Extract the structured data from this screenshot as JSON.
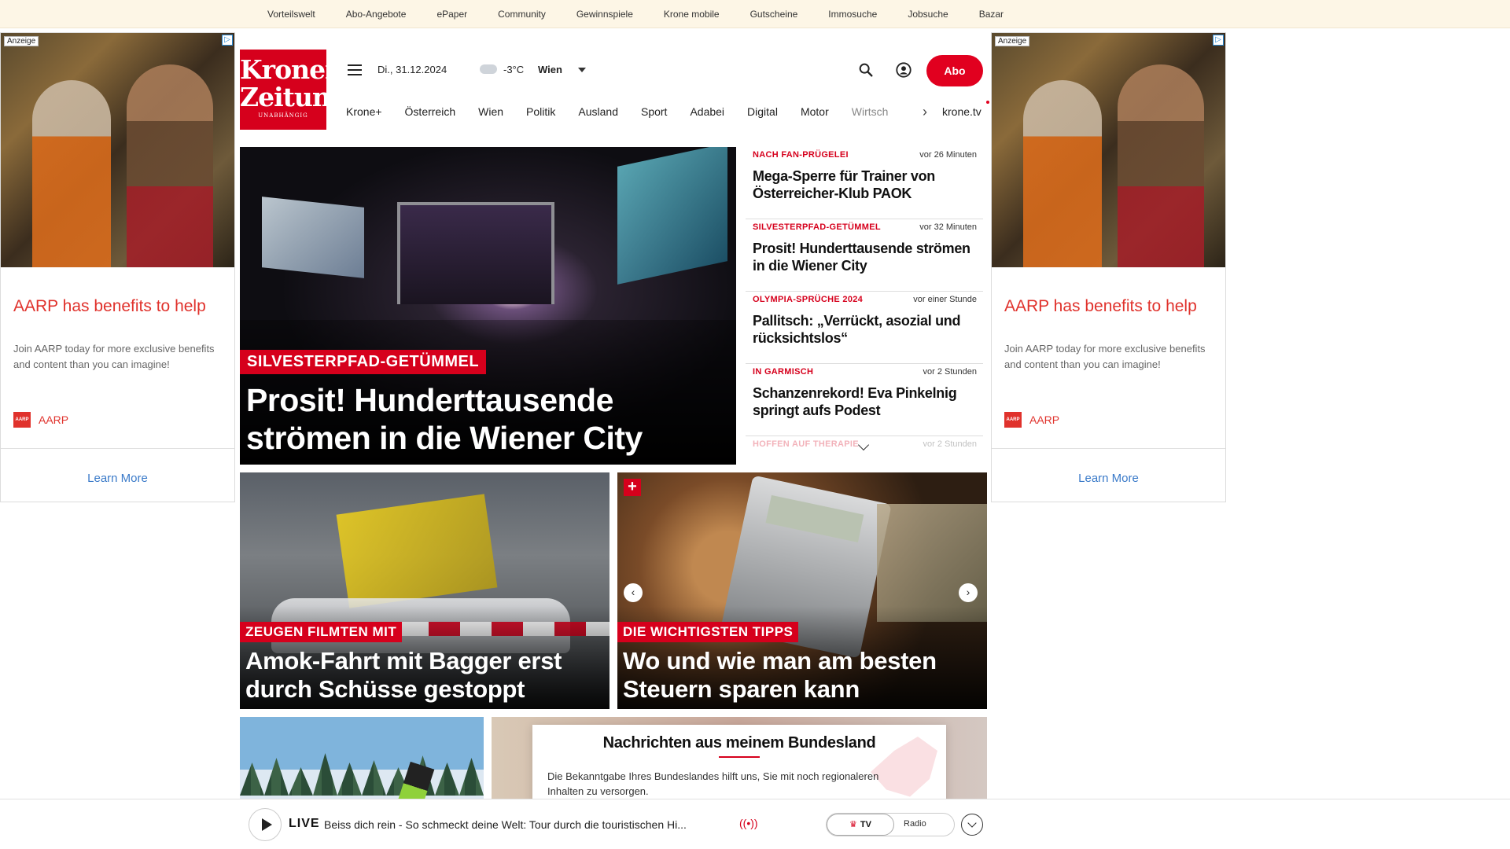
{
  "topbar": {
    "links": [
      "Vorteilswelt",
      "Abo-Angebote",
      "ePaper",
      "Community",
      "Gewinnspiele",
      "Krone mobile",
      "Gutscheine",
      "Immosuche",
      "Jobsuche",
      "Bazar"
    ]
  },
  "ad": {
    "badge": "Anzeige",
    "headline": "AARP has benefits to help",
    "body": "Join AARP today for more exclusive benefits and content than you can imagine!",
    "brand": "AARP",
    "cta": "Learn More"
  },
  "logo": {
    "line1": "Kronen",
    "line2": "Zeitung",
    "line3": "UNABHÄNGIG"
  },
  "header": {
    "date": "Di., 31.12.2024",
    "temperature": "-3°C",
    "city": "Wien",
    "abo_label": "Abo"
  },
  "nav": {
    "items": [
      "Krone+",
      "Österreich",
      "Wien",
      "Politik",
      "Ausland",
      "Sport",
      "Adabei",
      "Digital",
      "Motor",
      "Wirtsch"
    ],
    "ktv": "krone.tv"
  },
  "hero": {
    "kicker": "SILVESTERPFAD-GETÜMMEL",
    "title": "Prosit! Hunderttausende strömen in die Wiener City"
  },
  "news": [
    {
      "cat": "NACH FAN-PRÜGELEI",
      "time": "vor 26 Minuten",
      "head": "Mega-Sperre für Trainer von Österreicher-Klub PAOK"
    },
    {
      "cat": "SILVESTERPFAD-GETÜMMEL",
      "time": "vor 32 Minuten",
      "head": "Prosit! Hunderttausende strömen in die Wiener City"
    },
    {
      "cat": "OLYMPIA-SPRÜCHE 2024",
      "time": "vor einer Stunde",
      "head": "Pallitsch: „Verrückt, asozial und rücksichtslos“"
    },
    {
      "cat": "IN GARMISCH",
      "time": "vor 2 Stunden",
      "head": "Schanzenrekord! Eva Pinkelnig springt aufs Podest"
    },
    {
      "cat": "HOFFEN AUF THERAPIE",
      "time": "vor 2 Stunden",
      "head": ""
    }
  ],
  "cards": [
    {
      "kicker": "ZEUGEN FILMTEN MIT",
      "title": "Amok-Fahrt mit Bagger erst durch Schüsse gestoppt"
    },
    {
      "kicker": "DIE WICHTIGSTEN TIPPS",
      "title": "Wo und wie man am besten Steuern sparen kann"
    }
  ],
  "modal": {
    "title": "Nachrichten aus meinem Bundesland",
    "body": "Die Bekanntgabe Ihres Bundeslandes hilft uns, Sie mit noch regionaleren Inhalten zu versorgen."
  },
  "live": {
    "tag": "LIVE",
    "title": "Beiss dich rein - So schmeckt deine Welt: Tour durch die touristischen Hi...",
    "tv": "TV",
    "radio": "Radio"
  },
  "colors": {
    "brand_red": "#d6001c",
    "ad_headline": "#e0322c",
    "link_blue": "#3a7ac9"
  }
}
